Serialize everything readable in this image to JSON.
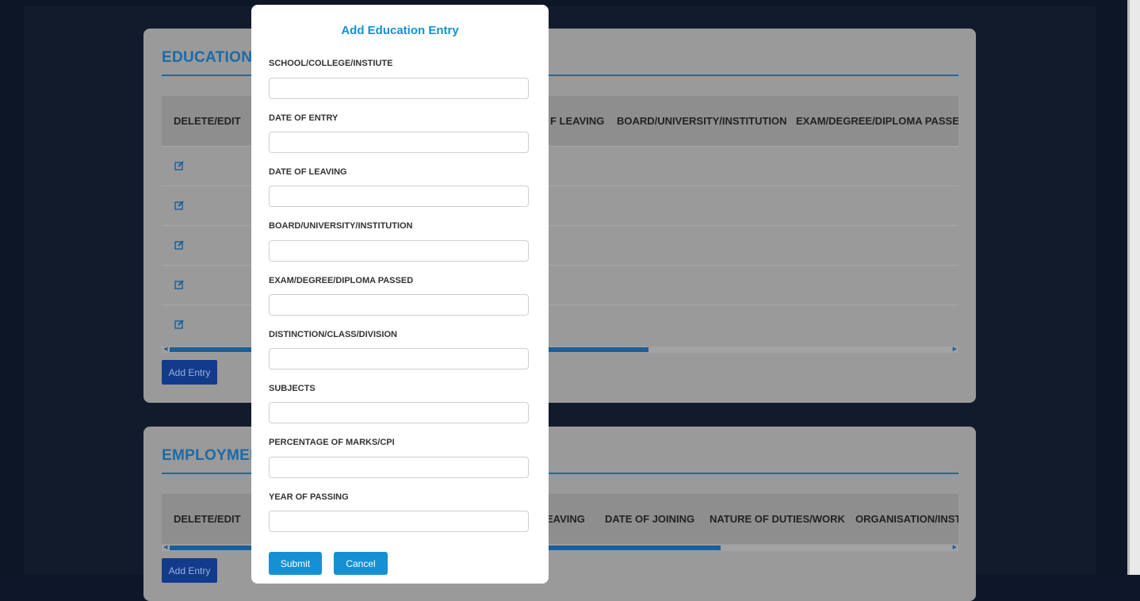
{
  "education_section": {
    "title": "EDUCATION",
    "columns": [
      "DELETE/EDIT",
      "F LEAVING",
      "BOARD/UNIVERSITY/INSTITUTION",
      "EXAM/DEGREE/DIPLOMA PASSED"
    ],
    "row_count": 5,
    "edit_icon": "edit-icon",
    "add_label": "Add Entry"
  },
  "employment_section": {
    "title": "EMPLOYMEN",
    "columns": [
      "DELETE/EDIT",
      "EAVING",
      "DATE OF JOINING",
      "NATURE OF DUTIES/WORK",
      "ORGANISATION/INSTIT"
    ],
    "add_label": "Add Entry"
  },
  "modal": {
    "title": "Add Education Entry",
    "fields": [
      {
        "label": "SCHOOL/COLLEGE/INSTIUTE",
        "value": "",
        "placeholder": ""
      },
      {
        "label": "DATE OF ENTRY",
        "value": "",
        "placeholder": ""
      },
      {
        "label": "DATE OF LEAVING",
        "value": "",
        "placeholder": ""
      },
      {
        "label": "BOARD/UNIVERSITY/INSTITUTION",
        "value": "",
        "placeholder": ""
      },
      {
        "label": "EXAM/DEGREE/DIPLOMA PASSED",
        "value": "",
        "placeholder": ""
      },
      {
        "label": "DISTINCTION/CLASS/DIVISION",
        "value": "",
        "placeholder": ""
      },
      {
        "label": "SUBJECTS",
        "value": "",
        "placeholder": ""
      },
      {
        "label": "PERCENTAGE OF MARKS/CPI",
        "value": "",
        "placeholder": ""
      },
      {
        "label": "YEAR OF PASSING",
        "value": "",
        "placeholder": ""
      }
    ],
    "submit_label": "Submit",
    "cancel_label": "Cancel"
  },
  "colors": {
    "accent": "#1591d3",
    "section_title": "#1a6aa8",
    "add_button": "#123b8c"
  }
}
